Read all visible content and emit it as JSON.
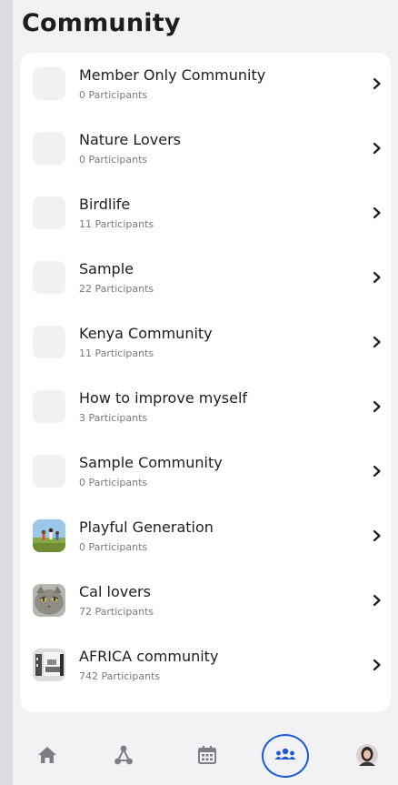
{
  "header": {
    "title": "Community"
  },
  "communities": [
    {
      "name": "Member Only Community",
      "participants": "0 Participants",
      "thumb": "blank"
    },
    {
      "name": "Nature Lovers",
      "participants": "0 Participants",
      "thumb": "blank"
    },
    {
      "name": "Birdlife",
      "participants": "11 Participants",
      "thumb": "blank"
    },
    {
      "name": "Sample",
      "participants": "22 Participants",
      "thumb": "blank"
    },
    {
      "name": "Kenya Community",
      "participants": "11 Participants",
      "thumb": "blank"
    },
    {
      "name": "How to improve myself",
      "participants": "3 Participants",
      "thumb": "blank"
    },
    {
      "name": "Sample Community",
      "participants": "0 Participants",
      "thumb": "blank"
    },
    {
      "name": "Playful Generation",
      "participants": "0 Participants",
      "thumb": "kids-photo"
    },
    {
      "name": "Cal lovers",
      "participants": "72 Participants",
      "thumb": "cat-photo"
    },
    {
      "name": "AFRICA community",
      "participants": "742 Participants",
      "thumb": "office-photo"
    }
  ],
  "tabbar": {
    "items": [
      {
        "icon": "home-icon"
      },
      {
        "icon": "network-icon"
      },
      {
        "icon": "calendar-icon"
      },
      {
        "icon": "community-icon",
        "active": true
      },
      {
        "icon": "profile-avatar"
      }
    ],
    "active_color": "#1a5ad8",
    "inactive_color": "#7d7d82"
  }
}
